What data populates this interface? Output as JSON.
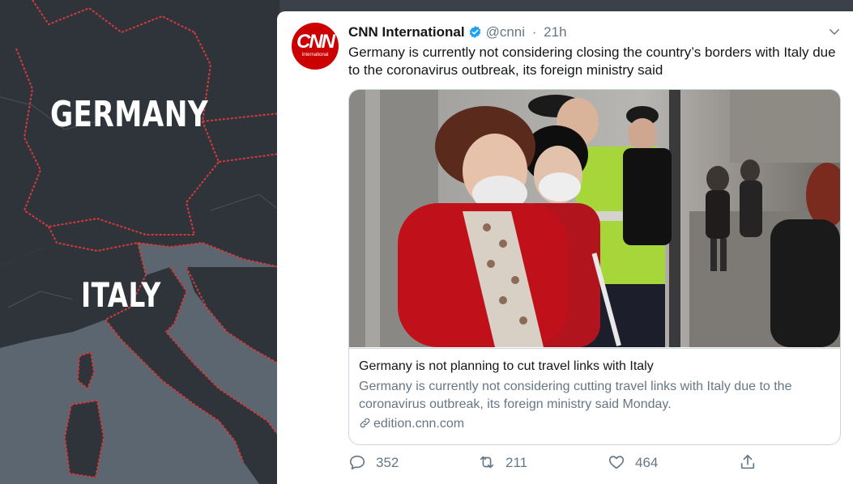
{
  "map": {
    "labels": {
      "germany": "GERMANY",
      "italy": "ITALY"
    }
  },
  "tweet": {
    "author_name": "CNN International",
    "handle": "@cnni",
    "separator": "·",
    "time": "21h",
    "avatar_text": "CNN",
    "avatar_subtext": "International",
    "text": "Germany is currently not considering closing the country’s borders with Italy due to the coronavirus outbreak, its foreign ministry said",
    "card": {
      "title": "Germany is not planning to cut travel links with Italy",
      "description": "Germany is currently not considering cutting travel links with Italy due to the coronavirus outbreak, its foreign ministry said Monday.",
      "domain": "edition.cnn.com"
    },
    "counts": {
      "replies": "352",
      "retweets": "211",
      "likes": "464"
    }
  },
  "colors": {
    "brand_red": "#cc0000",
    "verified_blue": "#1da1f2",
    "muted_text": "#657786",
    "border_red": "#d43a3a"
  },
  "icons": {
    "verified": "verified-badge-icon",
    "chevron": "chevron-down-icon",
    "reply": "reply-icon",
    "retweet": "retweet-icon",
    "like": "heart-icon",
    "share": "share-icon",
    "link": "link-icon"
  }
}
